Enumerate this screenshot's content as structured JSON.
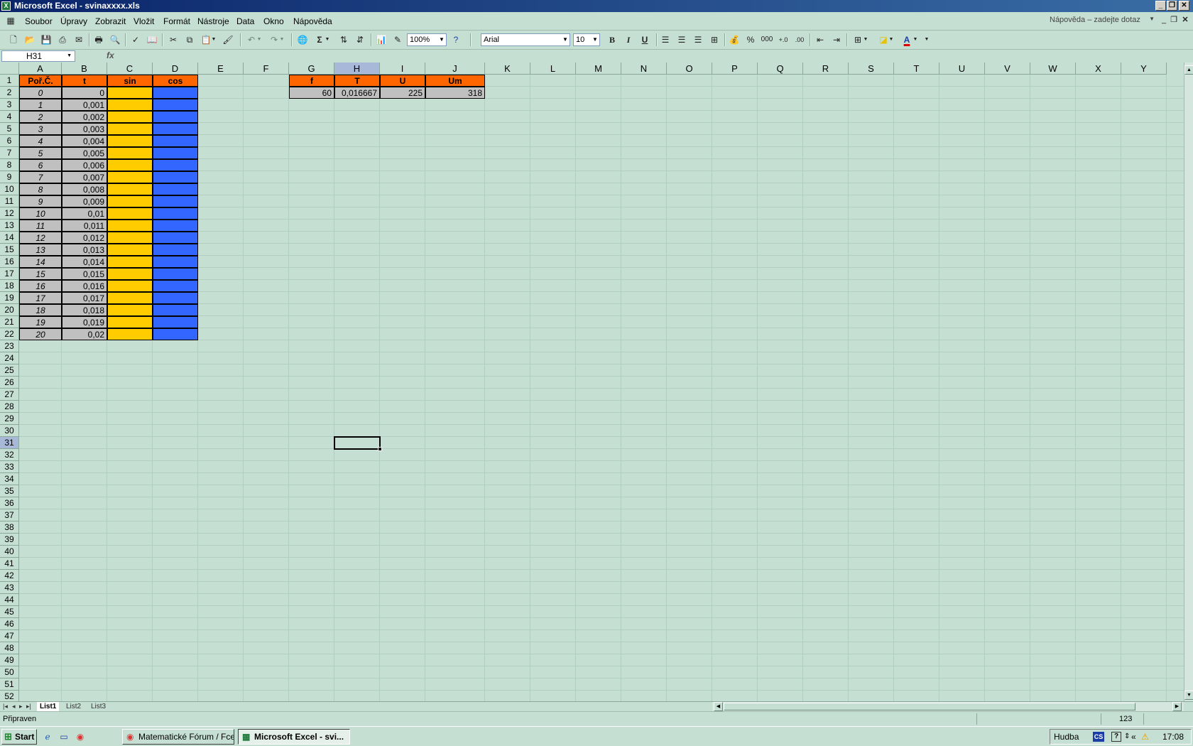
{
  "window": {
    "title": "Microsoft Excel - svinaxxxx.xls",
    "buttons": {
      "minimize": "_",
      "restore": "❐",
      "close": "✕"
    }
  },
  "menu": {
    "items": [
      "Soubor",
      "Úpravy",
      "Zobrazit",
      "Vložit",
      "Formát",
      "Nástroje",
      "Data",
      "Okno",
      "Nápověda"
    ],
    "help_placeholder": "Nápověda – zadejte dotaz"
  },
  "toolbar": {
    "zoom": "100%",
    "font_name": "Arial",
    "font_size": "10",
    "bold": "B",
    "italic": "I",
    "underline": "U",
    "percent": "%",
    "thousands": "000",
    "sum": "Σ",
    "font_color_letter": "A"
  },
  "formula_bar": {
    "name_box": "H31",
    "fx": "fx",
    "content": ""
  },
  "sheet": {
    "columns": [
      "A",
      "B",
      "C",
      "D",
      "E",
      "F",
      "G",
      "H",
      "I",
      "J",
      "K",
      "L",
      "M",
      "N",
      "O",
      "P",
      "Q",
      "R",
      "S",
      "T",
      "U",
      "V",
      "W",
      "X",
      "Y"
    ],
    "selected_column": "H",
    "selected_row": 31,
    "row_count": 52,
    "headers_left": [
      "Poř.Č.",
      "t",
      "sin",
      "cos"
    ],
    "headers_right": [
      "f",
      "T",
      "U",
      "Um"
    ],
    "right_values": [
      "60",
      "0,016667",
      "225",
      "318"
    ],
    "rows": [
      {
        "n": "0",
        "t": "0"
      },
      {
        "n": "1",
        "t": "0,001"
      },
      {
        "n": "2",
        "t": "0,002"
      },
      {
        "n": "3",
        "t": "0,003"
      },
      {
        "n": "4",
        "t": "0,004"
      },
      {
        "n": "5",
        "t": "0,005"
      },
      {
        "n": "6",
        "t": "0,006"
      },
      {
        "n": "7",
        "t": "0,007"
      },
      {
        "n": "8",
        "t": "0,008"
      },
      {
        "n": "9",
        "t": "0,009"
      },
      {
        "n": "10",
        "t": "0,01"
      },
      {
        "n": "11",
        "t": "0,011"
      },
      {
        "n": "12",
        "t": "0,012"
      },
      {
        "n": "13",
        "t": "0,013"
      },
      {
        "n": "14",
        "t": "0,014"
      },
      {
        "n": "15",
        "t": "0,015"
      },
      {
        "n": "16",
        "t": "0,016"
      },
      {
        "n": "17",
        "t": "0,017"
      },
      {
        "n": "18",
        "t": "0,018"
      },
      {
        "n": "19",
        "t": "0,019"
      },
      {
        "n": "20",
        "t": "0,02"
      }
    ]
  },
  "sheet_tabs": [
    "List1",
    "List2",
    "List3"
  ],
  "active_tab": "List1",
  "status": {
    "text": "Připraven",
    "numlock": "123"
  },
  "taskbar": {
    "start": "Start",
    "tasks": [
      "Matematické Fórum / Fce...",
      "Microsoft Excel - svi..."
    ],
    "tray_label": "Hudba",
    "language": "CS",
    "clock": "17:08"
  },
  "colors": {
    "header_orange": "#ff6600",
    "sin_yellow": "#ffcc00",
    "cos_blue": "#3366ff",
    "grey_cells": "#c0c0c0",
    "sheet_background": "#c6dfd3"
  }
}
